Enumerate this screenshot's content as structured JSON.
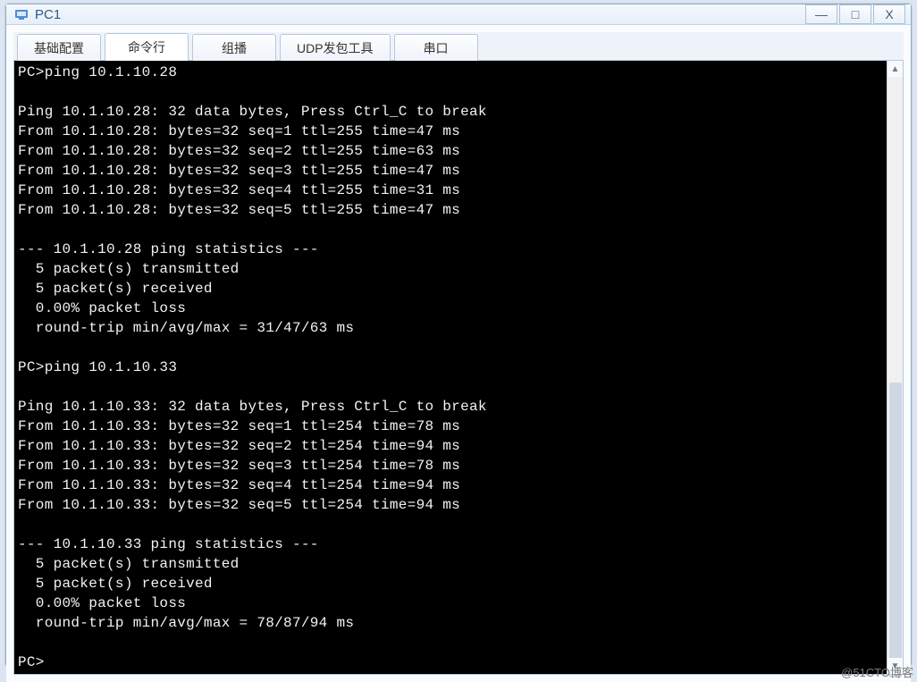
{
  "window": {
    "title": "PC1"
  },
  "controls": {
    "minimize": "—",
    "maximize": "□",
    "close": "X"
  },
  "tabs": [
    {
      "label": "基础配置",
      "active": false
    },
    {
      "label": "命令行",
      "active": true
    },
    {
      "label": "组播",
      "active": false
    },
    {
      "label": "UDP发包工具",
      "active": false
    },
    {
      "label": "串口",
      "active": false
    }
  ],
  "terminal": {
    "text": "PC>ping 10.1.10.28\n\nPing 10.1.10.28: 32 data bytes, Press Ctrl_C to break\nFrom 10.1.10.28: bytes=32 seq=1 ttl=255 time=47 ms\nFrom 10.1.10.28: bytes=32 seq=2 ttl=255 time=63 ms\nFrom 10.1.10.28: bytes=32 seq=3 ttl=255 time=47 ms\nFrom 10.1.10.28: bytes=32 seq=4 ttl=255 time=31 ms\nFrom 10.1.10.28: bytes=32 seq=5 ttl=255 time=47 ms\n\n--- 10.1.10.28 ping statistics ---\n  5 packet(s) transmitted\n  5 packet(s) received\n  0.00% packet loss\n  round-trip min/avg/max = 31/47/63 ms\n\nPC>ping 10.1.10.33\n\nPing 10.1.10.33: 32 data bytes, Press Ctrl_C to break\nFrom 10.1.10.33: bytes=32 seq=1 ttl=254 time=78 ms\nFrom 10.1.10.33: bytes=32 seq=2 ttl=254 time=94 ms\nFrom 10.1.10.33: bytes=32 seq=3 ttl=254 time=78 ms\nFrom 10.1.10.33: bytes=32 seq=4 ttl=254 time=94 ms\nFrom 10.1.10.33: bytes=32 seq=5 ttl=254 time=94 ms\n\n--- 10.1.10.33 ping statistics ---\n  5 packet(s) transmitted\n  5 packet(s) received\n  0.00% packet loss\n  round-trip min/avg/max = 78/87/94 ms\n\nPC>"
  },
  "watermark": "@51CTO博客"
}
